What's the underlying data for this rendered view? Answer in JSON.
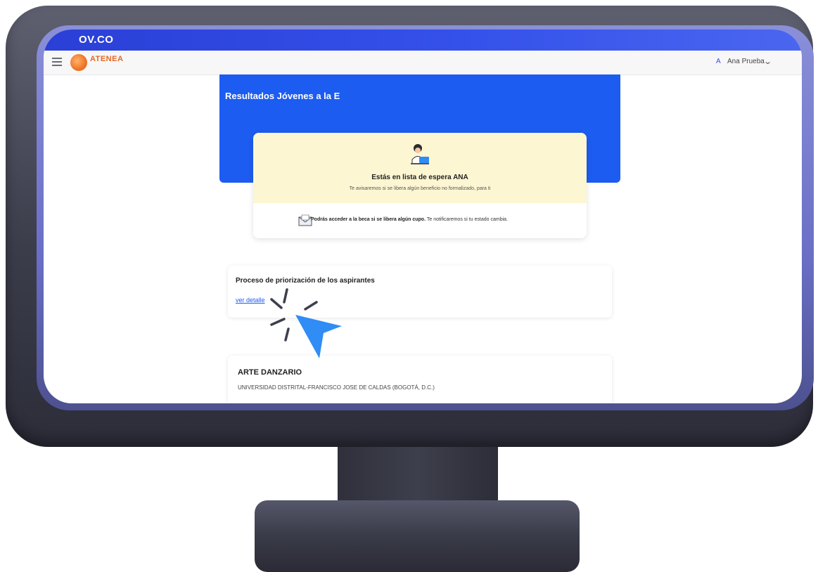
{
  "browser": {
    "url_fragment": "OV.CO"
  },
  "navbar": {
    "logo_text": "ATENEA",
    "user_initial": "A",
    "user_name": "Ana Prueba"
  },
  "hero": {
    "title": "Resultados Jóvenes a la E"
  },
  "waitlist": {
    "title": "Estás en lista de espera ANA",
    "subtitle": "Te avisaremos si se libera algún beneficio no formalizado, para ti",
    "note_bold": "Podrás acceder a la beca si se libera algún cupo.",
    "note_rest": " Te notificaremos si tu estado cambia."
  },
  "prioritization": {
    "title": "Proceso de priorización de los aspirantes",
    "link": "ver detalle"
  },
  "program": {
    "title": "ARTE DANZARIO",
    "university": "UNIVERSIDAD DISTRITAL-FRANCISCO JOSE DE CALDAS (BOGOTÁ, D.C.)"
  },
  "colors": {
    "brand_blue": "#1c5cf0",
    "brand_orange": "#e8661f",
    "waitlist_bg": "#fdf6d2",
    "cursor": "#2f8df5"
  },
  "icons": [
    "menu-icon",
    "atenea-logo",
    "chevron-down-icon",
    "student-illustration",
    "mail-icon",
    "pointer-cursor-icon"
  ]
}
